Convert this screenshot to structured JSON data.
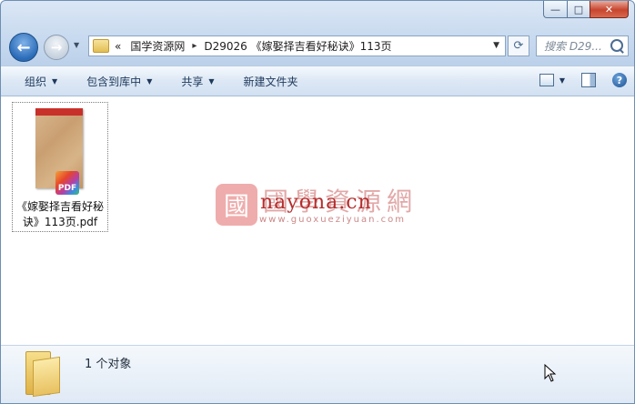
{
  "window": {
    "caption_buttons": {
      "minimize": "—",
      "maximize": "□",
      "close": "✕"
    }
  },
  "nav": {
    "back_glyph": "←",
    "forward_glyph": "→",
    "dropdown_glyph": "▼"
  },
  "address": {
    "overflow": "«",
    "crumbs": [
      "国学资源网",
      "D29026 《嫁娶择吉看好秘诀》113页"
    ],
    "separator": "▸",
    "dropdown_glyph": "▼",
    "refresh_glyph": "⟳"
  },
  "search": {
    "placeholder": "搜索 D29..."
  },
  "toolbar": {
    "organize": "组织",
    "include_in_library": "包含到库中",
    "share": "共享",
    "new_folder": "新建文件夹",
    "help": "?"
  },
  "files": [
    {
      "name": "《嫁娶择吉看好秘诀》113页.pdf",
      "badge": "PDF"
    }
  ],
  "watermark": {
    "logo_char": "國",
    "chinese": "國學資源網",
    "site": "nayona.cn",
    "pinyin": "www.guoxueziyuan.com"
  },
  "details": {
    "count": "1 个对象"
  }
}
